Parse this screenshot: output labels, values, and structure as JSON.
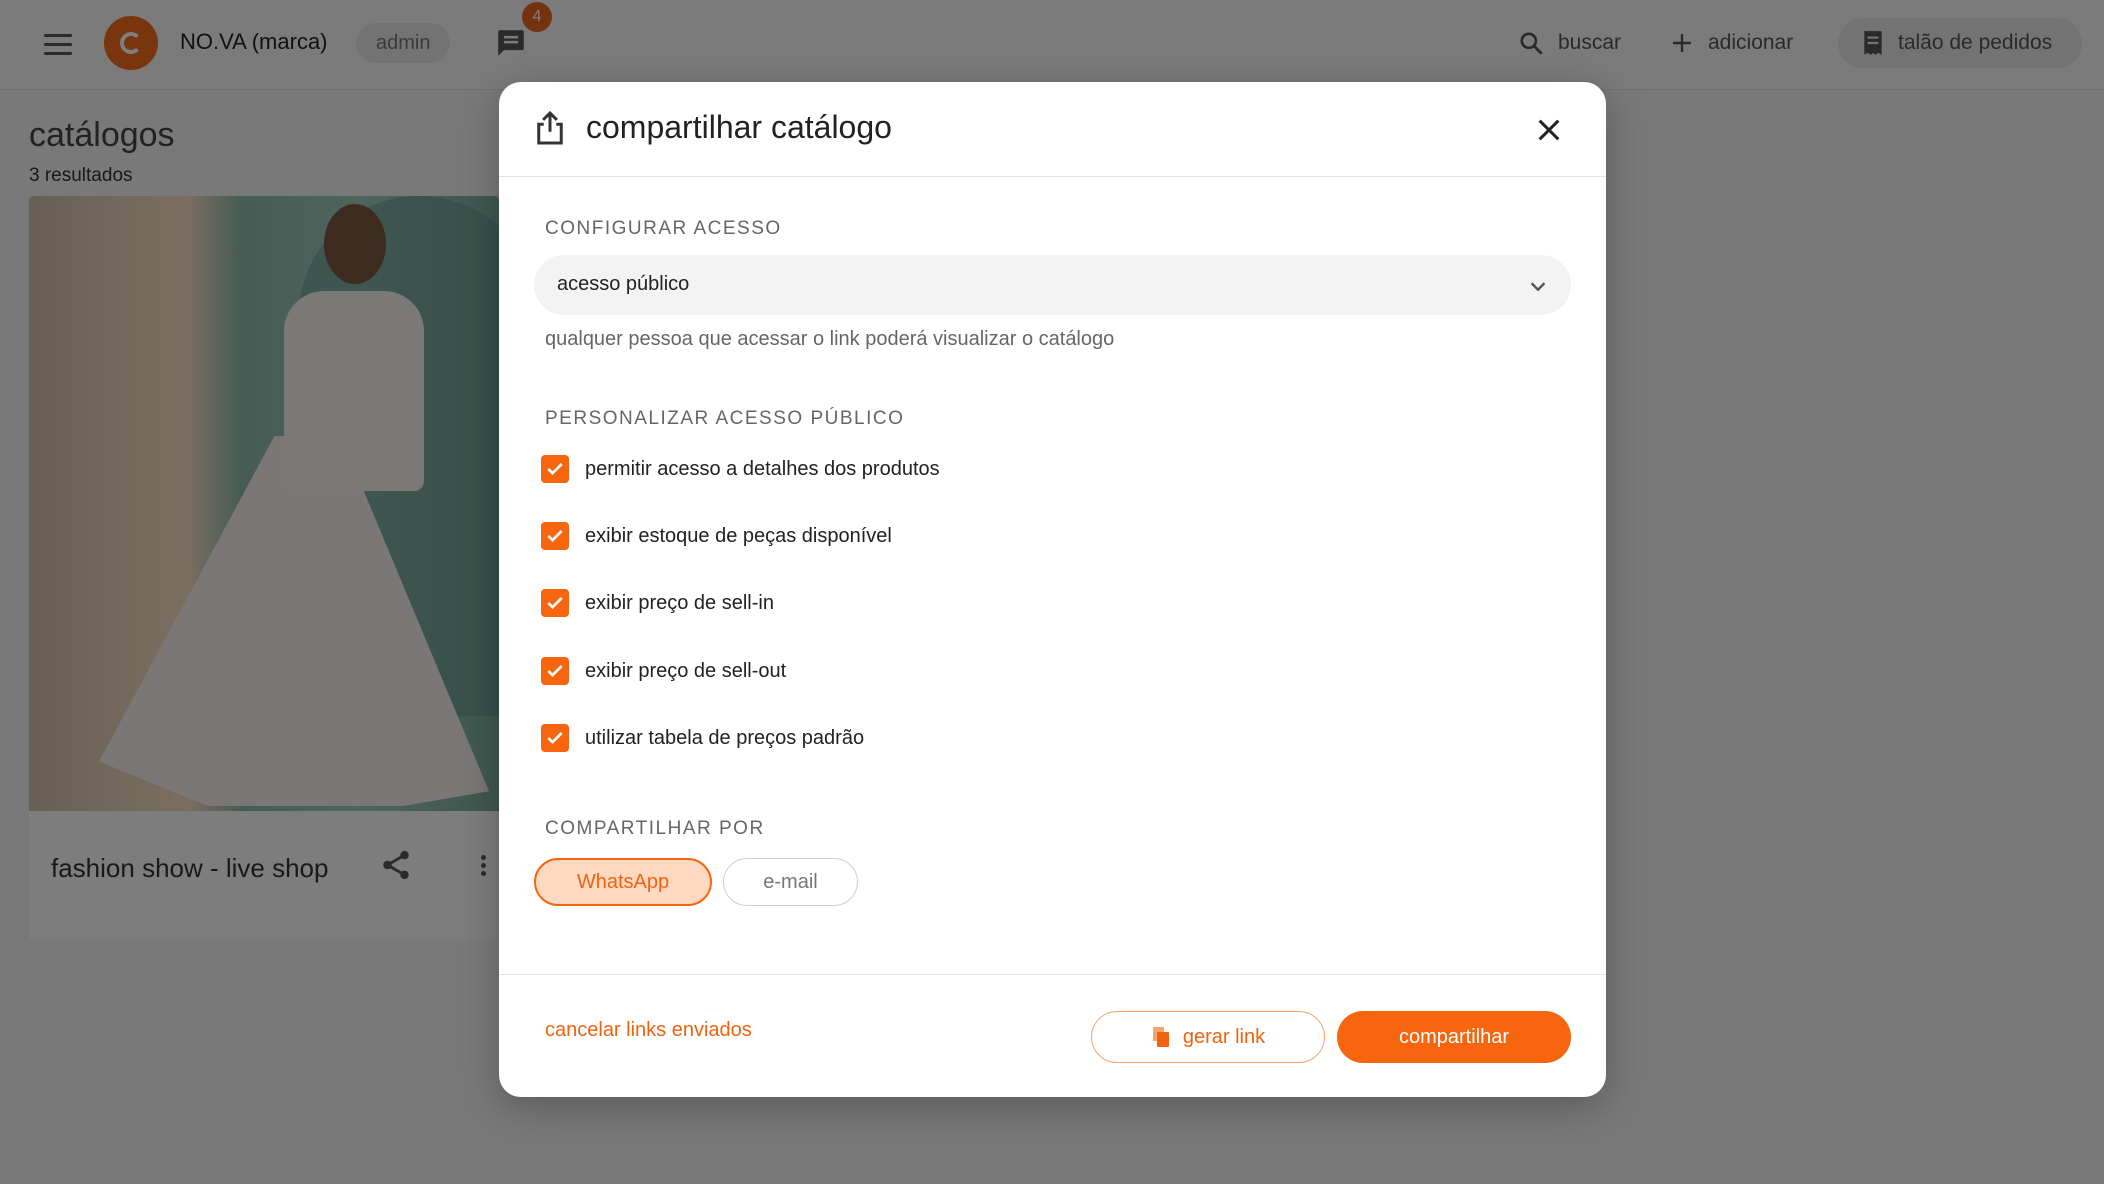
{
  "colors": {
    "accent": "#f7660e",
    "accent_soft": "#fdd9c2",
    "overlay": "#000000"
  },
  "topbar": {
    "brand_name": "NO.VA (marca)",
    "role": "admin",
    "notifications_count": "4",
    "search_label": "buscar",
    "add_label": "adicionar",
    "orders_label": "talão de pedidos",
    "icons": [
      "menu-icon",
      "brand-logo",
      "chat-icon",
      "search-icon",
      "plus-icon",
      "receipt-icon"
    ]
  },
  "page": {
    "title": "catálogos",
    "results": "3 resultados"
  },
  "catalog_card": {
    "title": "fashion show - live shop",
    "icons": [
      "share-icon",
      "more-vertical-icon"
    ]
  },
  "modal": {
    "title": "compartilhar catálogo",
    "access_section": "CONFIGURAR ACESSO",
    "access_value": "acesso público",
    "access_help": "qualquer pessoa que acessar o link poderá visualizar o catálogo",
    "custom_section": "PERSONALIZAR ACESSO PÚBLICO",
    "options": [
      {
        "label": "permitir acesso a detalhes dos produtos",
        "checked": true
      },
      {
        "label": "exibir estoque de peças disponível",
        "checked": true
      },
      {
        "label": "exibir preço de sell-in",
        "checked": true
      },
      {
        "label": "exibir preço de sell-out",
        "checked": true
      },
      {
        "label": "utilizar tabela de preços padrão",
        "checked": true
      }
    ],
    "share_section": "COMPARTILHAR POR",
    "share_channels": [
      {
        "label": "WhatsApp",
        "selected": true
      },
      {
        "label": "e-mail",
        "selected": false
      }
    ],
    "cancel_links": "cancelar links enviados",
    "generate_link": "gerar link",
    "share_button": "compartilhar"
  }
}
